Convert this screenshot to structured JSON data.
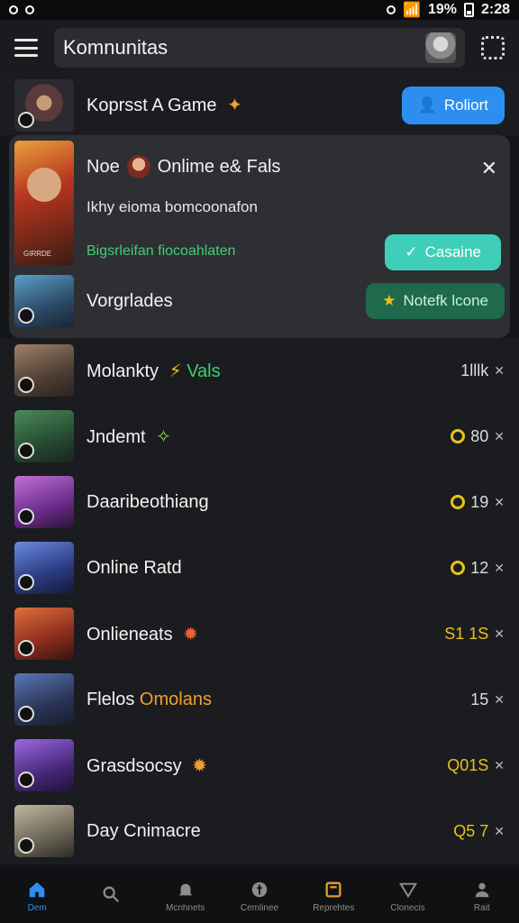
{
  "status_bar": {
    "battery": "19%",
    "time": "2:28"
  },
  "app_bar": {
    "title": "Komnunitas"
  },
  "first_row": {
    "name": "Koprsst A Game",
    "button": "Roliort"
  },
  "expanded_card": {
    "title": "Noe",
    "title_suffix": "Onlime e& Fals",
    "description": "Ikhy eioma bomcoonafon",
    "status": "Bigsrleifan fiocoahlaten",
    "primary_button": "Casaine",
    "secondary_name": "Vorgrlades",
    "secondary_button": "Notefk lcone",
    "thumb_caption": "GIRRDE"
  },
  "rows": [
    {
      "name": "Molankty",
      "tag": "Vals",
      "value": "1lllk",
      "coin": false
    },
    {
      "name": "Jndemt",
      "tag": "",
      "value": "80",
      "coin": true
    },
    {
      "name": "Daaribeothiang",
      "tag": "",
      "value": "19",
      "coin": true
    },
    {
      "name": "Online Ratd",
      "tag": "",
      "value": "12",
      "coin": true
    },
    {
      "name": "Onlieneats",
      "tag": "",
      "value": "S1 1S",
      "coin": false
    },
    {
      "name": "Flelos",
      "tag": "Omolans",
      "value": "15",
      "coin": false
    },
    {
      "name": "Grasdsocsy",
      "tag": "",
      "value": "Q01S",
      "coin": false
    },
    {
      "name": "Day Cnimacre",
      "tag": "",
      "value": "Q5 7",
      "coin": false
    }
  ],
  "bottom_nav": [
    {
      "label": "Dem",
      "icon": "home-icon"
    },
    {
      "label": "",
      "icon": "search-icon"
    },
    {
      "label": "Mcnhnets",
      "icon": "bell-icon"
    },
    {
      "label": "Cemlinee",
      "icon": "compass-icon"
    },
    {
      "label": "Reprehtes",
      "icon": "box-icon"
    },
    {
      "label": "Clonecis",
      "icon": "triangle-icon"
    },
    {
      "label": "Rait",
      "icon": "person-icon"
    }
  ],
  "colors": {
    "accent": "#2c8ff0",
    "teal": "#3fcfb8",
    "green_status": "#3fd070",
    "gold": "#e6c21c",
    "orange": "#f0a030"
  }
}
